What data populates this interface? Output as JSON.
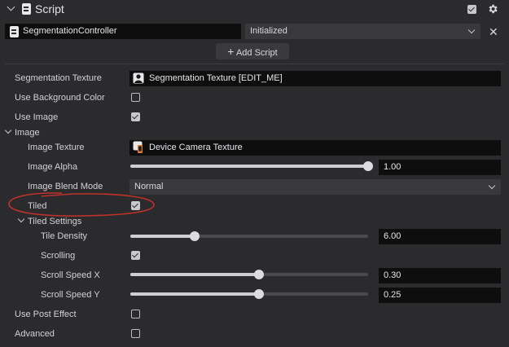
{
  "header": {
    "title": "Script",
    "enabled": true
  },
  "script_row": {
    "name": "SegmentationController",
    "state": "Initialized",
    "add_label": "Add Script"
  },
  "props": {
    "seg_texture": {
      "label": "Segmentation Texture",
      "value": "Segmentation Texture [EDIT_ME]"
    },
    "use_bg_color": {
      "label": "Use Background Color",
      "checked": false
    },
    "use_image": {
      "label": "Use Image",
      "checked": true
    },
    "image_group": {
      "label": "Image"
    },
    "image_texture": {
      "label": "Image Texture",
      "value": "Device Camera Texture"
    },
    "image_alpha": {
      "label": "Image Alpha",
      "value": "1.00",
      "fraction": 1.0
    },
    "blend_mode": {
      "label": "Image Blend Mode",
      "value": "Normal"
    },
    "tiled": {
      "label": "Tiled",
      "checked": true
    },
    "tiled_settings": {
      "label": "Tiled Settings"
    },
    "tile_density": {
      "label": "Tile Density",
      "value": "6.00",
      "fraction": 0.27
    },
    "scrolling": {
      "label": "Scrolling",
      "checked": true
    },
    "scroll_x": {
      "label": "Scroll Speed X",
      "value": "0.30",
      "fraction": 0.54
    },
    "scroll_y": {
      "label": "Scroll Speed Y",
      "value": "0.25",
      "fraction": 0.54
    },
    "use_post": {
      "label": "Use Post Effect",
      "checked": false
    },
    "advanced": {
      "label": "Advanced",
      "checked": false
    }
  },
  "colors": {
    "panel": "#2b2b2d",
    "field": "#0e0e0f",
    "annotation": "#c0322b"
  }
}
